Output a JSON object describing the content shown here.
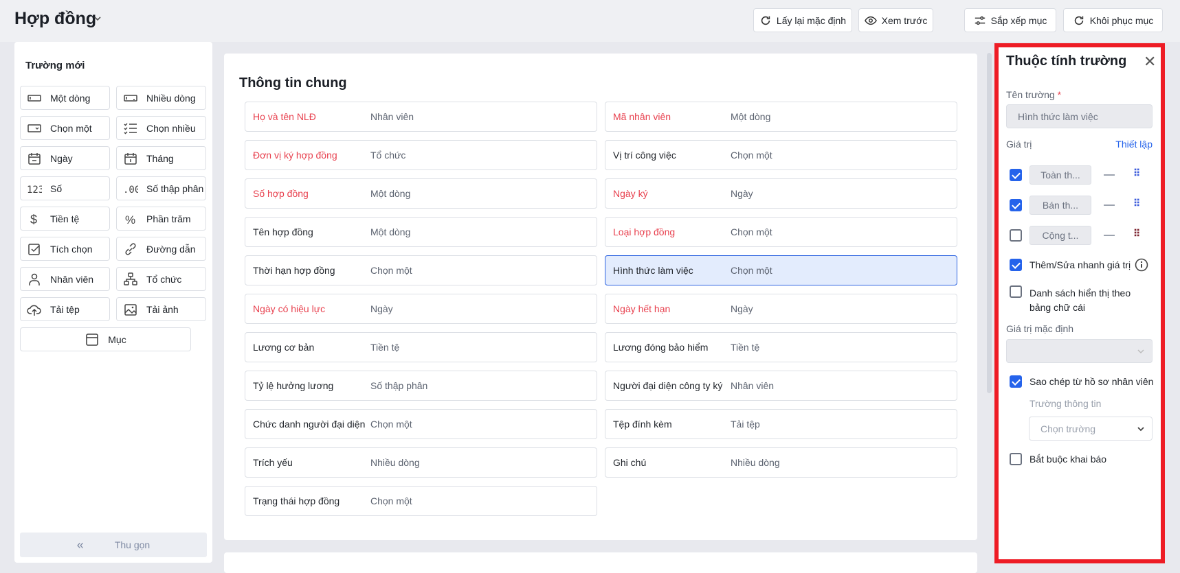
{
  "header": {
    "title": "Hợp đồng",
    "buttons": [
      "Lấy lại mặc định",
      "Xem trước",
      "Sắp xếp mục",
      "Khôi phục mục"
    ]
  },
  "left": {
    "title": "Trường mới",
    "fields": [
      "Một dòng",
      "Nhiều dòng",
      "Chọn một",
      "Chọn nhiều",
      "Ngày",
      "Tháng",
      "Số",
      "Số thập phân",
      "Tiền tệ",
      "Phần trăm",
      "Tích chọn",
      "Đường dẫn",
      "Nhân viên",
      "Tổ chức",
      "Tải tệp",
      "Tải ảnh"
    ],
    "section": "Mục",
    "collapse": "Thu gọn"
  },
  "main": {
    "title": "Thông tin chung",
    "rows": [
      {
        "label": "Họ và tên NLĐ",
        "type": "Nhân viên",
        "required": true
      },
      {
        "label": "Mã nhân viên",
        "type": "Một dòng",
        "required": true
      },
      {
        "label": "Đơn vị ký hợp đồng",
        "type": "Tổ chức",
        "required": true
      },
      {
        "label": "Vị trí công việc",
        "type": "Chọn một",
        "required": false
      },
      {
        "label": "Số hợp đồng",
        "type": "Một dòng",
        "required": true
      },
      {
        "label": "Ngày ký",
        "type": "Ngày",
        "required": true
      },
      {
        "label": "Tên hợp đồng",
        "type": "Một dòng",
        "required": false
      },
      {
        "label": "Loại hợp đồng",
        "type": "Chọn một",
        "required": true
      },
      {
        "label": "Thời hạn hợp đồng",
        "type": "Chọn một",
        "required": false
      },
      {
        "label": "Hình thức làm việc",
        "type": "Chọn một",
        "required": false,
        "selected": true
      },
      {
        "label": "Ngày có hiệu lực",
        "type": "Ngày",
        "required": true
      },
      {
        "label": "Ngày hết hạn",
        "type": "Ngày",
        "required": true
      },
      {
        "label": "Lương cơ bản",
        "type": "Tiền tệ",
        "required": false
      },
      {
        "label": "Lương đóng bảo hiểm",
        "type": "Tiền tệ",
        "required": false
      },
      {
        "label": "Tỷ lệ hưởng lương",
        "type": "Số thập phân",
        "required": false
      },
      {
        "label": "Người đại diện công ty ký",
        "type": "Nhân viên",
        "required": false
      },
      {
        "label": "Chức danh người đại diện",
        "type": "Chọn một",
        "required": false
      },
      {
        "label": "Tệp đính kèm",
        "type": "Tải tệp",
        "required": false
      },
      {
        "label": "Trích yếu",
        "type": "Nhiều dòng",
        "required": false
      },
      {
        "label": "Ghi chú",
        "type": "Nhiều dòng",
        "required": false
      },
      {
        "label": "Trạng thái hợp đồng",
        "type": "Chọn một",
        "required": false
      }
    ]
  },
  "panel": {
    "title": "Thuộc tính trường",
    "name_label": "Tên trường",
    "required_mark": "*",
    "name_value": "Hình thức làm việc",
    "values_label": "Giá trị",
    "setup_link": "Thiết lập",
    "options": [
      {
        "text": "Toàn th...",
        "checked": true
      },
      {
        "text": "Bán th...",
        "checked": true
      },
      {
        "text": "Cộng t...",
        "checked": false
      }
    ],
    "quick_edit": "Thêm/Sửa nhanh giá trị",
    "alpha_1": "Danh sách hiển thị theo",
    "alpha_2": "bảng chữ cái",
    "default_label": "Giá trị mặc định",
    "copy_label": "Sao chép từ hồ sơ nhân viên",
    "info_field_label": "Trường thông tin",
    "info_field_placeholder": "Chọn trường",
    "mandatory": "Bắt buộc khai báo"
  },
  "colors": {
    "accent": "#2563eb",
    "required": "#e8404e",
    "highlight": "#ee1c25"
  }
}
